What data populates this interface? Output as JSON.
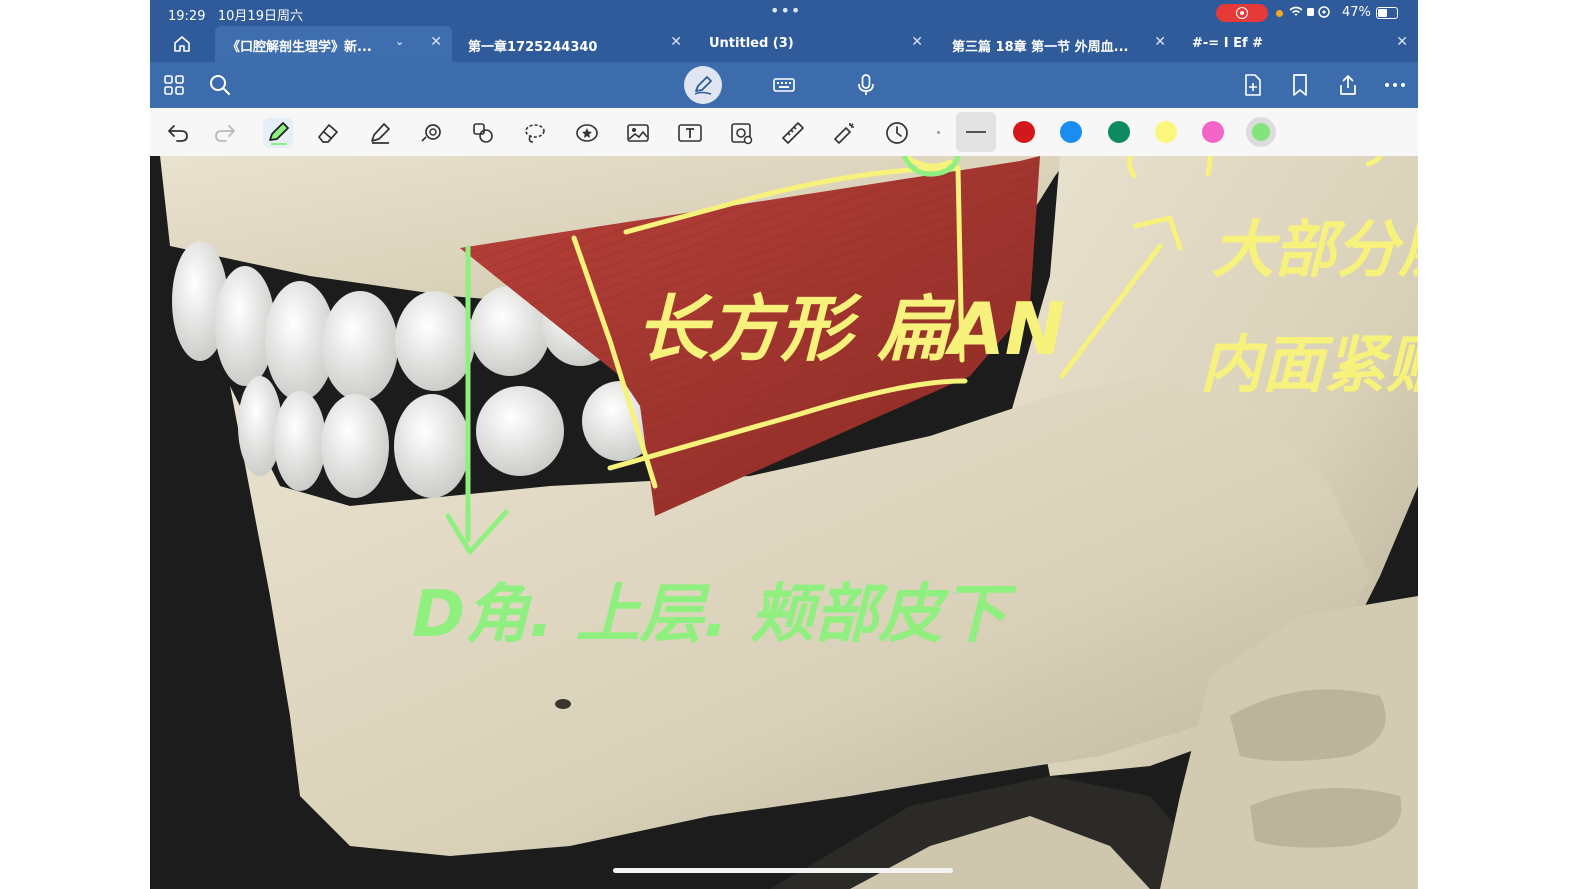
{
  "status_bar": {
    "time": "19:29",
    "date": "10月19日周六",
    "battery": "47%"
  },
  "tabs": [
    {
      "label": "《口腔解剖生理学》新...",
      "active": true
    },
    {
      "label": "第一章1725244340",
      "active": false
    },
    {
      "label": "Untitled (3)",
      "active": false
    },
    {
      "label": "第三篇 18章 第一节 外周血...",
      "active": false
    },
    {
      "label": "#-= I Ef #",
      "active": false
    }
  ],
  "toolbar": {
    "left_icons": [
      "grid-icon",
      "search-icon"
    ],
    "center_icons": [
      "pen-mode-icon",
      "keyboard-icon",
      "microphone-icon"
    ],
    "right_icons": [
      "add-page-icon",
      "bookmark-icon",
      "share-icon",
      "more-icon"
    ]
  },
  "drawing_tools": [
    "undo",
    "redo",
    "pen",
    "eraser",
    "highlighter",
    "shapes",
    "elements",
    "lasso",
    "sticker",
    "image",
    "text",
    "camera",
    "ruler",
    "laser-pointer",
    "recent"
  ],
  "colors": {
    "chrome": "#2f5b9b",
    "toolbar": "#3d6cad",
    "palette": [
      "#d3171a",
      "#1b8cf0",
      "#0e8a62",
      "#fbf77e",
      "#f465c8",
      "#84e47c"
    ],
    "annotation_yellow": "#f6f27b",
    "annotation_green": "#8ff07f"
  },
  "canvas": {
    "description_free": true,
    "annotations": [
      {
        "text": "长方形 扁AN",
        "color": "yellow"
      },
      {
        "text": "大部分层",
        "color": "yellow"
      },
      {
        "text": "内面紧贴",
        "color": "yellow"
      },
      {
        "text": "D角. 上层. 颊部皮下",
        "color": "green"
      }
    ]
  }
}
